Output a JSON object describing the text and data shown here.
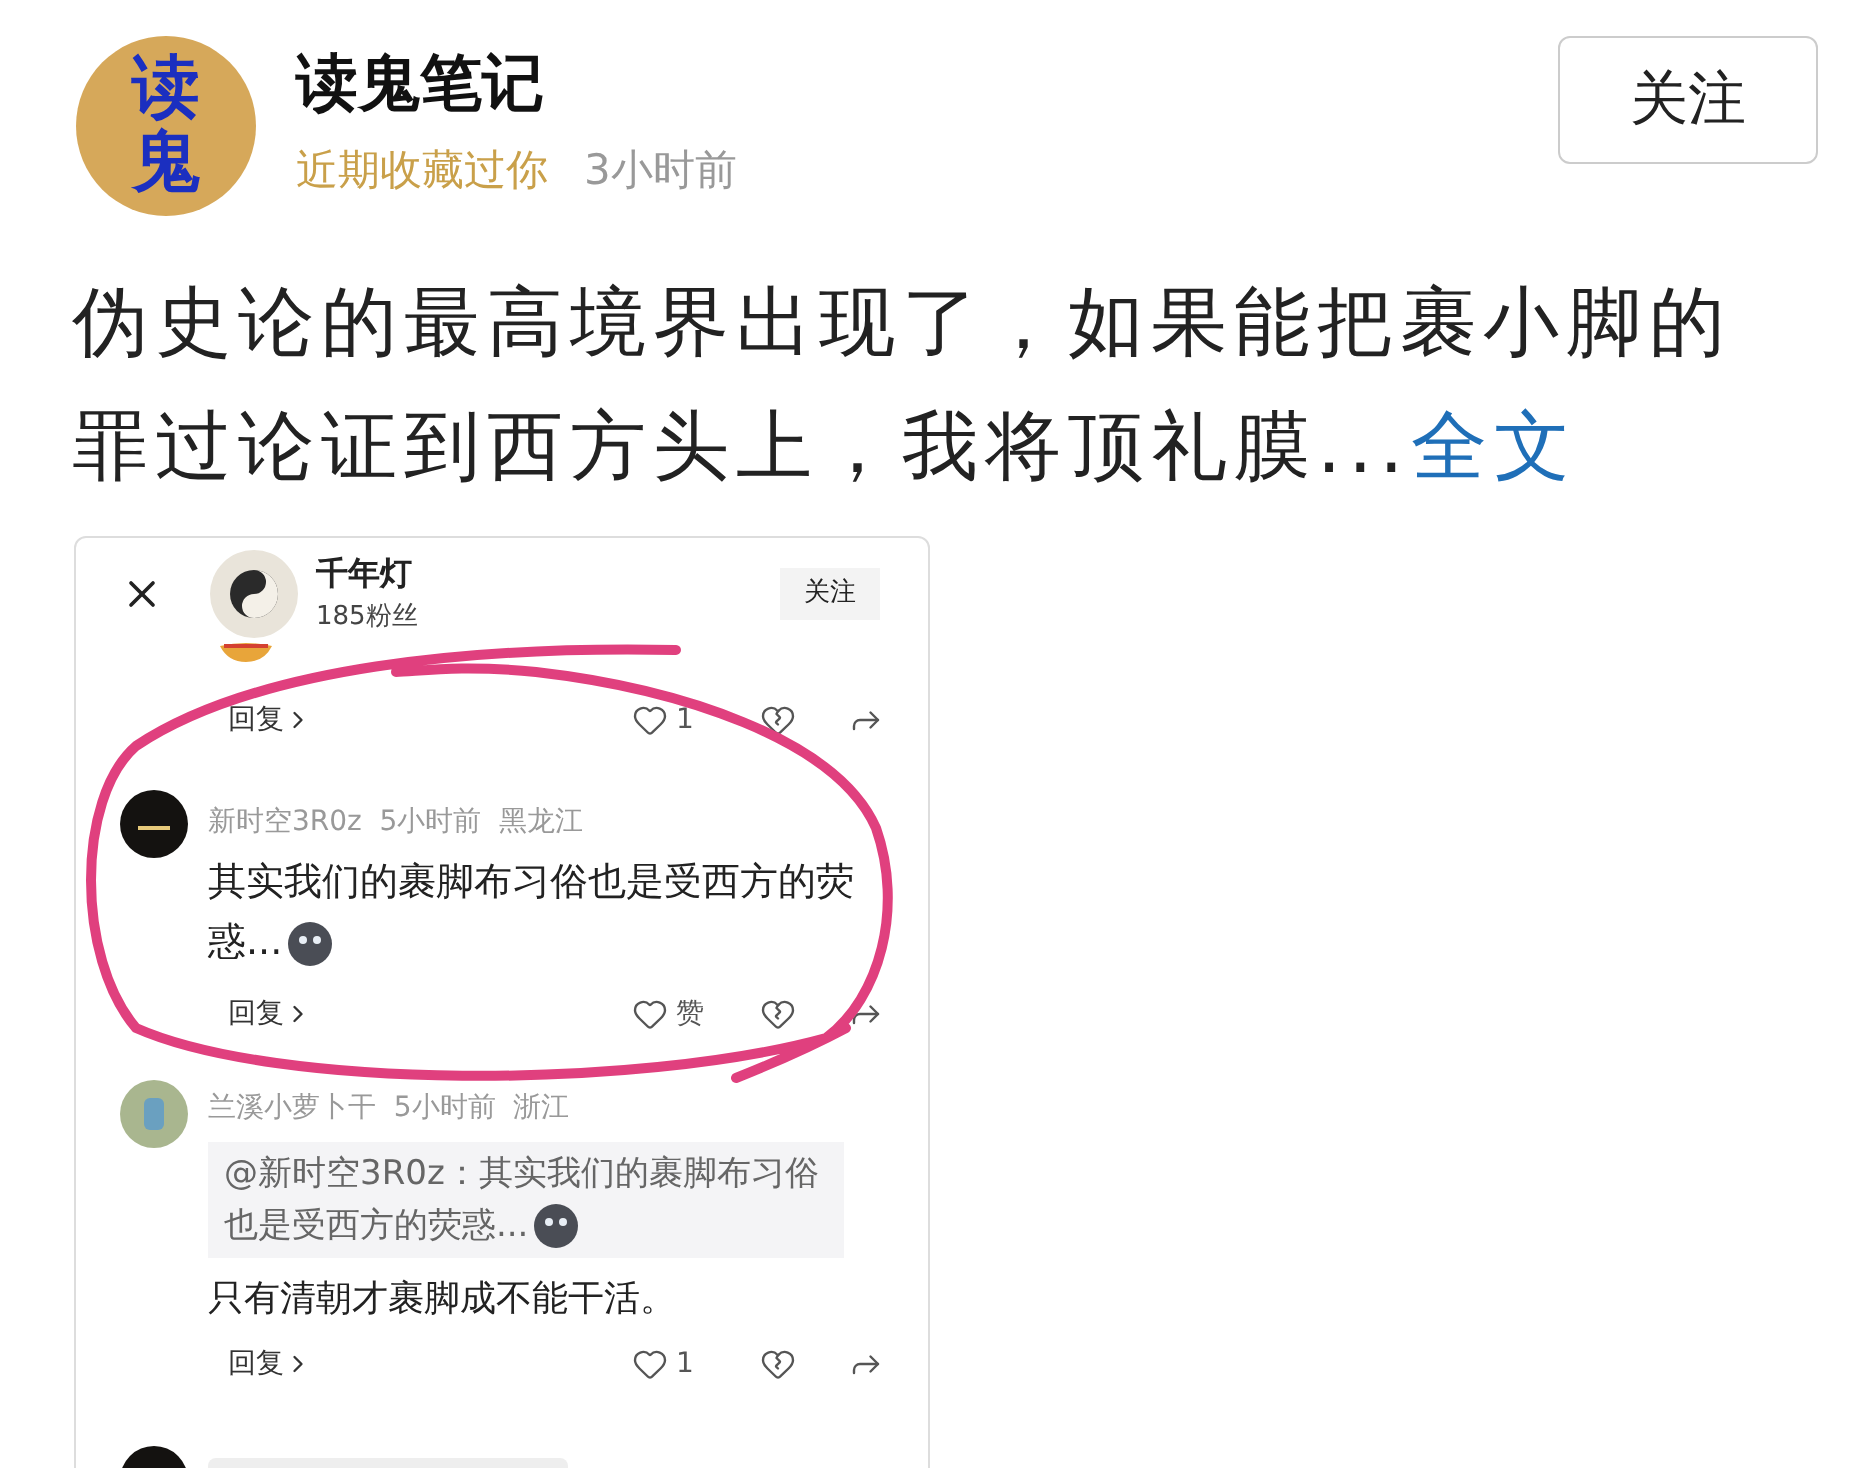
{
  "post": {
    "author": {
      "avatar_text": "读鬼",
      "name": "读鬼笔记",
      "badge": "近期收藏过你",
      "time": "3小时前"
    },
    "follow_button": "关注",
    "text": "伪史论的最高境界出现了，如果能把裹小脚的罪过论证到西方头上，我将顶礼膜...",
    "expand_link": "全文"
  },
  "embedded_screenshot": {
    "profile": {
      "name": "千年灯",
      "followers": "185粉丝"
    },
    "follow_button": "关注",
    "comments": [
      {
        "kind": "fragment",
        "reply": "回复",
        "like": "1"
      },
      {
        "kind": "comment",
        "color": "#141210",
        "author": "新时空3R0z",
        "time": "5小时前",
        "location": "黑龙江",
        "text": "其实我们的裹脚布习俗也是受西方的荧惑...",
        "reply": "回复",
        "like": "赞"
      },
      {
        "kind": "reply",
        "color": "#a9b68f",
        "author": "兰溪小萝卜干",
        "time": "5小时前",
        "location": "浙江",
        "quote": "@新时空3R0z：其实我们的裹脚布习俗也是受西方的荧惑...",
        "text": "只有清朝才裹脚成不能干活。",
        "reply": "回复",
        "like": "1"
      },
      {
        "kind": "hidden",
        "color": "#141210"
      }
    ]
  }
}
